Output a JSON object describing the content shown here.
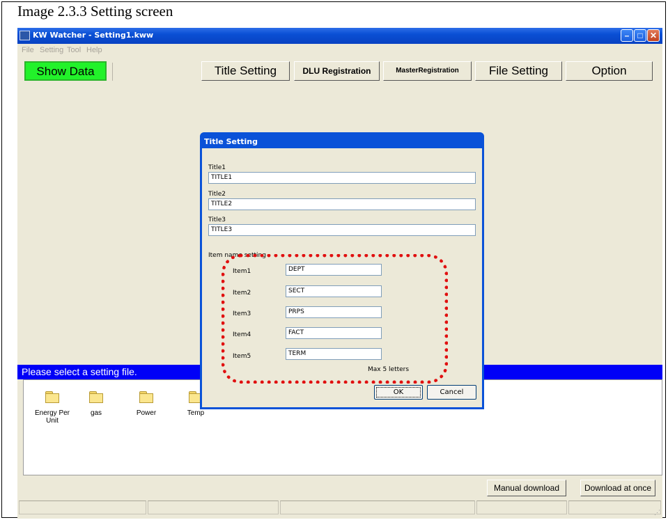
{
  "caption": "Image 2.3.3 Setting screen",
  "window": {
    "title": "KW Watcher - Setting1.kww",
    "menu": [
      "File",
      "Setting",
      "Tool",
      "Help"
    ]
  },
  "toolbar": {
    "show_data": "Show Data",
    "title_setting": "Title Setting",
    "dlu_registration": "DLU Registration",
    "master_registration": "MasterRegistration",
    "file_setting": "File Setting",
    "option": "Option"
  },
  "status_message": "Please select a setting file.",
  "folders": [
    "Energy Per Unit",
    "gas",
    "Power",
    "Temp"
  ],
  "bottom": {
    "manual_download": "Manual download",
    "download_at_once": "Download at once"
  },
  "dialog": {
    "title": "Title Setting",
    "title1_label": "Title1",
    "title1_value": "TITLE1",
    "title2_label": "Title2",
    "title2_value": "TITLE2",
    "title3_label": "Title3",
    "title3_value": "TITLE3",
    "item_section_label": "Item name setting",
    "items": [
      {
        "label": "Item1",
        "value": "DEPT"
      },
      {
        "label": "Item2",
        "value": "SECT"
      },
      {
        "label": "Item3",
        "value": "PRPS"
      },
      {
        "label": "Item4",
        "value": "FACT"
      },
      {
        "label": "Item5",
        "value": "TERM"
      }
    ],
    "max_note": "Max 5 letters",
    "ok": "OK",
    "cancel": "Cancel"
  },
  "colors": {
    "show_data_bg": "#22f22a",
    "status_blue": "#0000f7",
    "highlight_red": "#e01010",
    "titlebar_blue": "#0a4fd4"
  }
}
